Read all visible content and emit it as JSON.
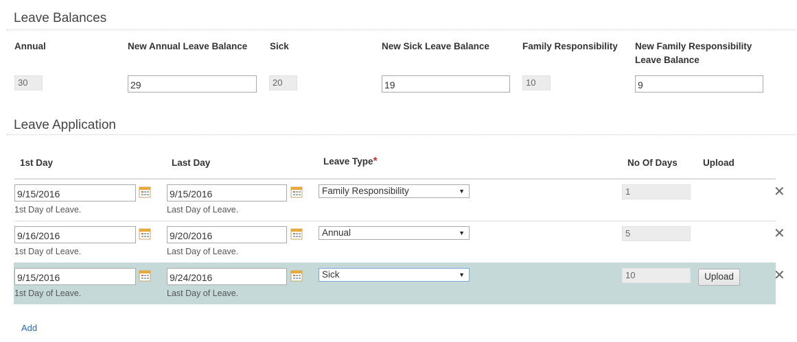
{
  "balances": {
    "title": "Leave Balances",
    "headers": {
      "annual": "Annual",
      "new_annual": "New Annual Leave Balance",
      "sick": "Sick",
      "new_sick": "New Sick Leave Balance",
      "family": "Family Responsibility",
      "new_family_line1": "New Family Responsibility",
      "new_family_line2": "Leave Balance"
    },
    "values": {
      "annual": "30",
      "new_annual": "29",
      "sick": "20",
      "new_sick": "19",
      "family": "10",
      "new_family": "9"
    }
  },
  "application": {
    "title": "Leave Application",
    "headers": {
      "first_day": "1st Day",
      "last_day": "Last Day",
      "leave_type": "Leave Type",
      "required_marker": "*",
      "no_of_days": "No Of Days",
      "upload": "Upload"
    },
    "rows": [
      {
        "first_day": "9/15/2016",
        "first_hint": "1st Day of Leave.",
        "last_day": "9/15/2016",
        "last_hint": "Last Day of Leave.",
        "leave_type": "Family Responsibility",
        "days": "1"
      },
      {
        "first_day": "9/16/2016",
        "first_hint": "1st Day of Leave.",
        "last_day": "9/20/2016",
        "last_hint": "Last Day of Leave.",
        "leave_type": "Annual",
        "days": "5"
      },
      {
        "first_day": "9/15/2016",
        "first_hint": "1st Day of Leave.",
        "last_day": "9/24/2016",
        "last_hint": "Last Day of Leave.",
        "leave_type": "Sick",
        "days": "10",
        "upload_label": "Upload"
      }
    ],
    "add_label": "Add"
  },
  "icons": {
    "calendar": "calendar-icon",
    "remove": "close-icon",
    "remove_glyph": "✕",
    "dropdown_glyph": "▼"
  },
  "colors": {
    "highlight_row": "#c5d9d8",
    "link": "#2a6ab8",
    "required": "#c0392b"
  }
}
